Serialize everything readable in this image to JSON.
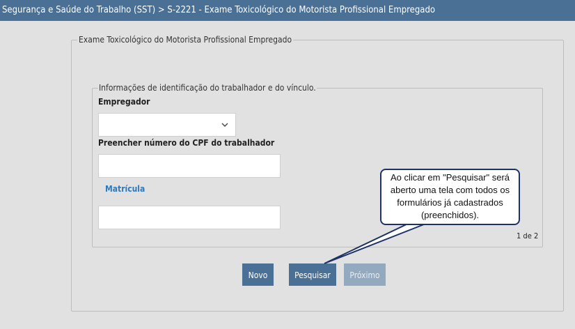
{
  "breadcrumb": "Segurança e Saúde do Trabalho (SST) > S-2221 - Exame Toxicológico do Motorista Profissional Empregado",
  "form": {
    "legend": "Exame Toxicológico do Motorista Profissional Empregado",
    "identification": {
      "legend": "Informações de identificação do trabalhador e do vínculo.",
      "employer_label": "Empregador",
      "employer_value": "",
      "cpf_label": "Preencher número do CPF do trabalhador",
      "cpf_value": "",
      "matricula_label": "Matrícula",
      "matricula_value": "",
      "pager": "1 de 2"
    },
    "buttons": {
      "new": "Novo",
      "search": "Pesquisar",
      "next": "Próximo"
    }
  },
  "callout": {
    "text": "Ao clicar em \"Pesquisar\" será aberto uma tela com todos os formulários já cadastrados (preenchidos)."
  },
  "colors": {
    "header": "#4a7096",
    "primary_button": "#4a7096",
    "disabled_button": "#93a9c0",
    "link_label": "#2b79bf",
    "callout_border": "#1f3266"
  },
  "icons": {
    "employer_dropdown": "chevron-down-icon"
  }
}
